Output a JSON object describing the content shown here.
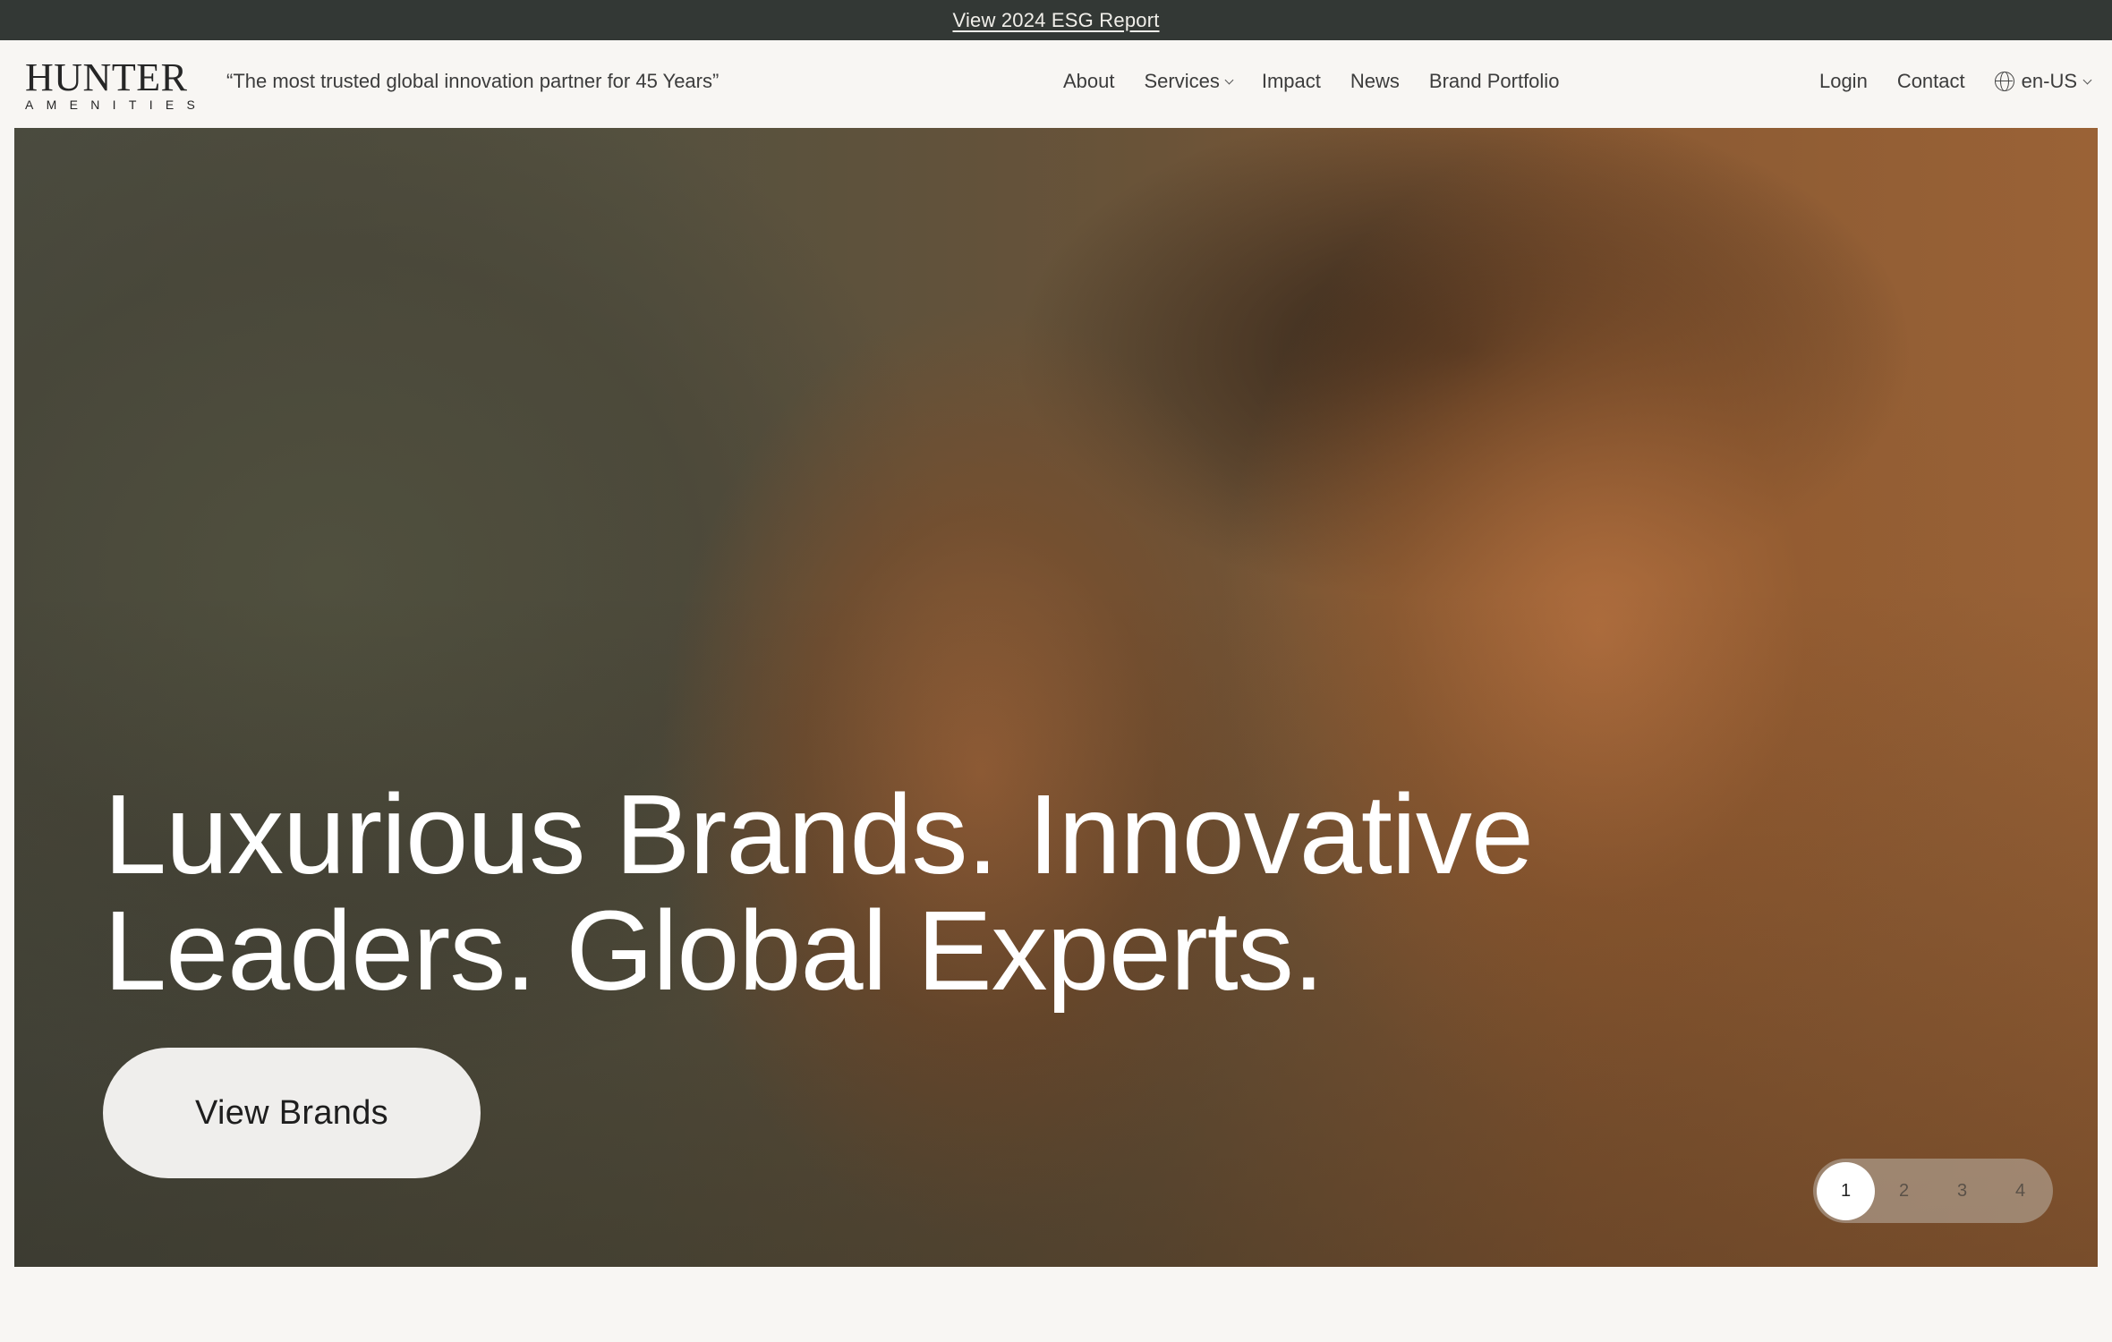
{
  "announcement": {
    "link_text": "View 2024 ESG Report"
  },
  "header": {
    "logo": {
      "word": "HUNTER",
      "sub": "AMENITIES"
    },
    "tagline": "“The most trusted global innovation partner for 45 Years”",
    "nav": [
      {
        "label": "About"
      },
      {
        "label": "Services",
        "has_dropdown": true
      },
      {
        "label": "Impact"
      },
      {
        "label": "News"
      },
      {
        "label": "Brand Portfolio"
      }
    ],
    "login": "Login",
    "contact": "Contact",
    "language": "en-US"
  },
  "hero": {
    "title_line1": "Luxurious Brands. Innovative",
    "title_line2": "Leaders. Global Experts.",
    "cta": "View Brands",
    "slides": [
      "1",
      "2",
      "3",
      "4"
    ],
    "active_slide": "1"
  },
  "colors": {
    "announcement_bg": "#333835",
    "page_bg": "#f8f6f3",
    "button_bg": "#efeeec",
    "hero_text": "#ffffff"
  }
}
